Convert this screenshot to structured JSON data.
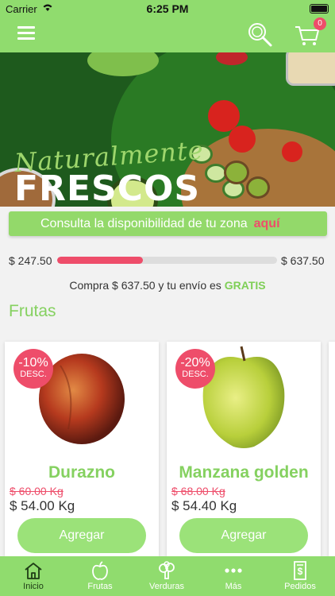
{
  "status_bar": {
    "carrier": "Carrier",
    "time": "6:25 PM"
  },
  "header": {
    "cart_count": "0"
  },
  "banner": {
    "script_text": "Naturalmente",
    "title": "FRESCOS"
  },
  "zone": {
    "text": "Consulta la disponibilidad de tu zona",
    "link": "aquí"
  },
  "shipping": {
    "current": "$ 247.50",
    "target": "$ 637.50",
    "progress": 0.39,
    "message": "Compra $ 637.50 y tu envío es",
    "free_label": "GRATIS"
  },
  "section": {
    "title": "Frutas"
  },
  "products": [
    {
      "discount": "-10%",
      "discount_label": "DESC.",
      "name": "Durazno",
      "old_price": "$ 60.00 Kg",
      "price": "$ 54.00 Kg",
      "button": "Agregar"
    },
    {
      "discount": "-20%",
      "discount_label": "DESC.",
      "name": "Manzana golden",
      "old_price": "$ 68.00 Kg",
      "price": "$ 54.40 Kg",
      "button": "Agregar"
    }
  ],
  "tabs": [
    {
      "label": "Inicio",
      "icon": "home-icon"
    },
    {
      "label": "Frutas",
      "icon": "apple-icon"
    },
    {
      "label": "Verduras",
      "icon": "broccoli-icon"
    },
    {
      "label": "Más",
      "icon": "more-dots-icon"
    },
    {
      "label": "Pedidos",
      "icon": "receipt-icon"
    }
  ],
  "colors": {
    "brand_green": "#90dc6e",
    "accent_pink": "#ee4d6a",
    "text_green": "#85d160"
  }
}
